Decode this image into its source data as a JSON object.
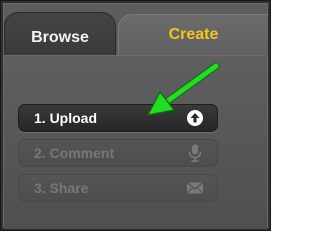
{
  "tabs": [
    {
      "label": "Browse",
      "active": false
    },
    {
      "label": "Create",
      "active": true
    }
  ],
  "steps": [
    {
      "label": "1. Upload",
      "icon": "upload-circle-icon",
      "enabled": true
    },
    {
      "label": "2. Comment",
      "icon": "microphone-icon",
      "enabled": false
    },
    {
      "label": "3. Share",
      "icon": "envelope-icon",
      "enabled": false
    }
  ],
  "colors": {
    "active_tab_text": "#f5c518",
    "annotation_arrow": "#22dd22"
  }
}
